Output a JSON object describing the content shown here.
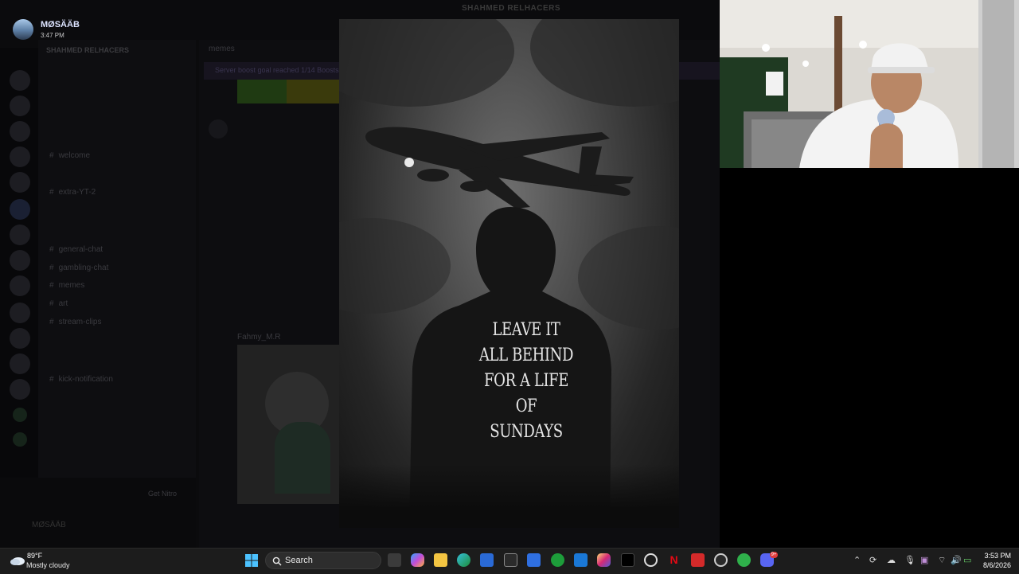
{
  "discord": {
    "dim_title": "SHAHMED RELHACERS",
    "server_name": "SHAHMED RELHACERS",
    "search_placeholder": "memes",
    "banner": "Server boost goal reached 1/14 Boosts",
    "message_author": "Fahmy_M.R",
    "get_nitro": "Get Nitro",
    "username": "MØSÄÄB",
    "channels": [
      "welcome",
      "extra-YT-2",
      "general-chat",
      "gambling-chat",
      "memes",
      "art",
      "stream-clips",
      "kick-notification"
    ]
  },
  "profile": {
    "name": "MØSÄÄB",
    "time": "3:47 PM"
  },
  "image": {
    "hoodie_text": [
      "LEAVE IT",
      "ALL BEHIND",
      "FOR A LIFE",
      "OF SUNDAYS"
    ]
  },
  "taskbar": {
    "temperature": "89°F",
    "condition": "Mostly cloudy",
    "search_label": "Search",
    "time": "3:53 PM",
    "date": "8/6/2026",
    "discord_badge": "9+",
    "apps": [
      "task-view",
      "copilot",
      "file-explorer",
      "edge",
      "store",
      "app-unity",
      "visual-studio",
      "xbox",
      "outlook",
      "instagram",
      "tiktok",
      "chatgpt",
      "netflix",
      "app-red-e",
      "app-record",
      "app-green",
      "discord"
    ]
  },
  "colors": {
    "accent": "#5865f2",
    "taskbar": "#1c1c1c"
  }
}
